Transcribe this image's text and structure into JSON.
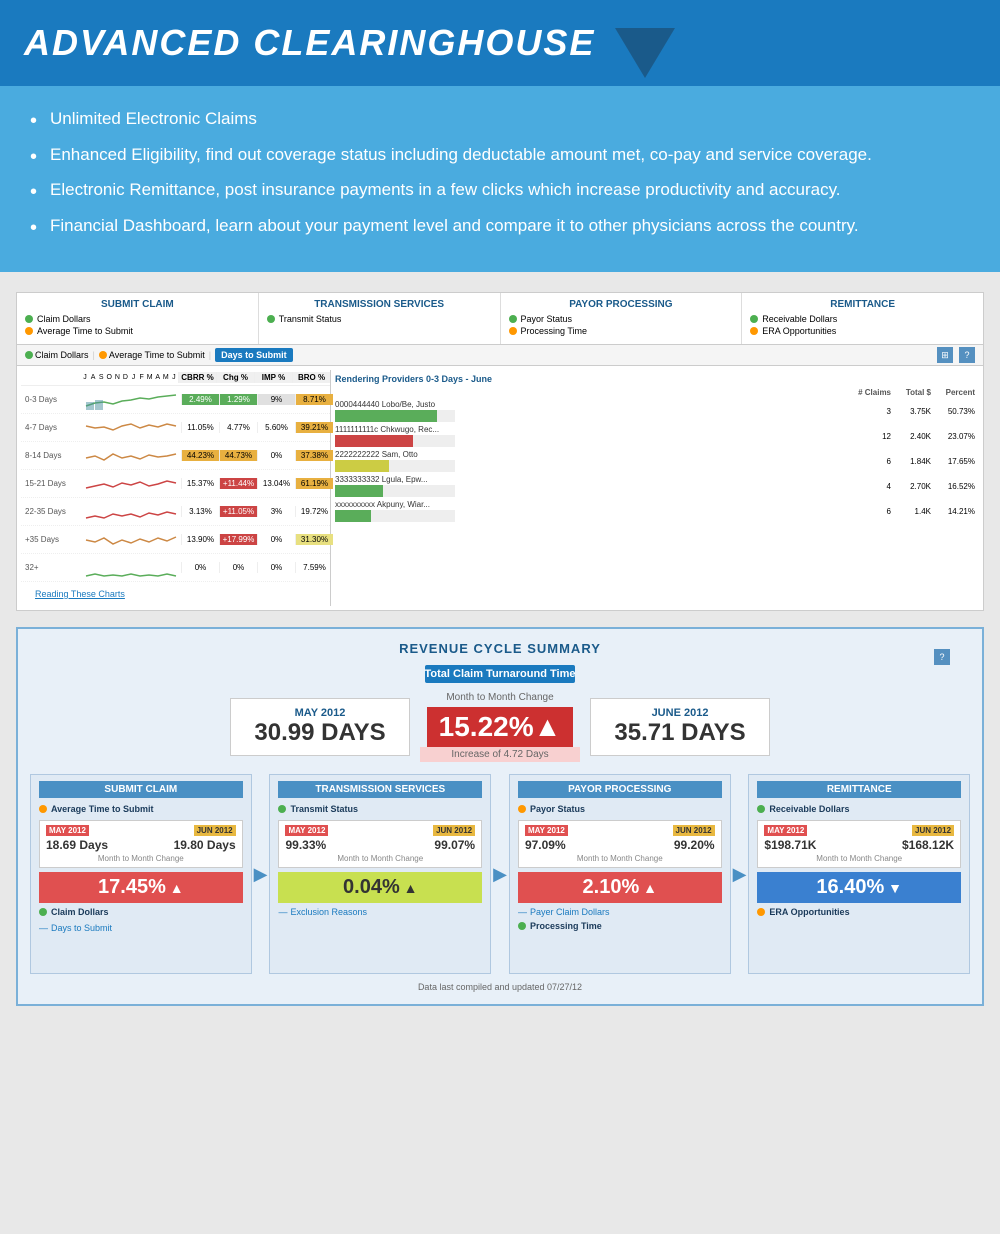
{
  "header": {
    "title": "ADVANCED CLEARINGHOUSE"
  },
  "features": [
    "Unlimited Electronic Claims",
    "Enhanced Eligibility, find out coverage status including deductable amount met, co-pay and service coverage.",
    "Electronic Remittance, post insurance payments in a few clicks which increase productivity and accuracy.",
    "Financial Dashboard, learn about your payment level and compare it to other physicians across the country."
  ],
  "panel1": {
    "columns": [
      {
        "title": "SUBMIT CLAIM",
        "items": [
          "Claim Dollars",
          "Average Time to Submit"
        ]
      },
      {
        "title": "TRANSMISSION SERVICES",
        "items": [
          "Transmit Status"
        ]
      },
      {
        "title": "PAYOR PROCESSING",
        "items": [
          "Payor Status",
          "Processing Time"
        ]
      },
      {
        "title": "REMITTANCE",
        "items": [
          "Receivable Dollars",
          "ERA Opportunities"
        ]
      }
    ],
    "tabs": [
      "Claim Dollars",
      "Average Time to Submit",
      "Days to Submit"
    ],
    "active_tab": "Days to Submit",
    "chart_months": [
      "J",
      "A",
      "S",
      "O",
      "N",
      "D",
      "J",
      "F",
      "M",
      "A",
      "M",
      "J"
    ],
    "chart_rows": [
      {
        "label": "0-3 Days",
        "cbrr": "2.49%",
        "chg": "1.29%",
        "imp": "9%",
        "bro": "8.71%"
      },
      {
        "label": "4-7 Days",
        "cbrr": "11.05%",
        "chg": "4.77%",
        "imp": "5.60%",
        "bro": "39.21%"
      },
      {
        "label": "8-14 Days",
        "cbrr": "44.23%",
        "chg": "44.73%",
        "imp": "0%",
        "bro": "37.38%"
      },
      {
        "label": "15-21 Days",
        "cbrr": "15.37%",
        "chg": "+11.44%",
        "imp": "13.04%",
        "bro": "61.19%"
      },
      {
        "label": "22-35 Days",
        "cbrr": "3.13%",
        "chg": "+11.05%",
        "imp": "3%",
        "bro": "19.72%"
      },
      {
        "label": "+35 Days",
        "cbrr": "13.90%",
        "chg": "+17.99%",
        "imp": "0%",
        "bro": "31.30%"
      },
      {
        "label": "32+",
        "cbrr": "0%",
        "chg": "0%",
        "imp": "0%",
        "bro": "7.59%"
      }
    ],
    "stat_headers": [
      "CBRR %",
      "Chg %",
      "IMP %",
      "BRO %"
    ],
    "provider_section": {
      "title": "Rendering Providers 0-3 Days - June",
      "headers": [
        "# Claims",
        "Total $",
        "Percent"
      ],
      "providers": [
        {
          "name": "0000444440 Lobo/Be, Justo",
          "bar_color": "#5aad5a",
          "bar_width": "85%",
          "claims": "3",
          "total": "3.75K",
          "pct": "50.73%"
        },
        {
          "name": "1111111111c Chkwugo, Rec...",
          "bar_color": "#cc4444",
          "bar_width": "65%",
          "claims": "12",
          "total": "2.40K",
          "pct": "23.07%"
        },
        {
          "name": "2222222222 Sam, Otto",
          "bar_color": "#cccc44",
          "bar_width": "45%",
          "claims": "6",
          "total": "1.84K",
          "pct": "17.65%"
        },
        {
          "name": "3333333332 Lgula, Epw...",
          "bar_color": "#5aad5a",
          "bar_width": "40%",
          "claims": "4",
          "total": "2.70K",
          "pct": "16.52%"
        },
        {
          "name": "xxxxxxxxxx Akpuny, Wiar...",
          "bar_color": "#5aad5a",
          "bar_width": "30%",
          "claims": "6",
          "total": "1.4K",
          "pct": "14.21%"
        }
      ]
    },
    "reading_charts": "Reading These Charts"
  },
  "rcs": {
    "title": "REVENUE CYCLE SUMMARY",
    "subtitle": "Total Claim Turnaround Time",
    "may_label": "MAY 2012",
    "may_value": "30.99 DAYS",
    "change_label": "Month to Month Change",
    "change_pct": "15.22%",
    "change_arrow": "▲",
    "change_sub": "Increase of 4.72 Days",
    "june_label": "JUNE 2012",
    "june_value": "35.71 DAYS",
    "bottom_cols": [
      {
        "title": "SUBMIT CLAIM",
        "metric1_label": "Average Time to Submit",
        "may_date": "MAY 2012",
        "jun_date": "JUN 2012",
        "may_val": "18.69 Days",
        "jun_val": "19.80 Days",
        "change_label": "Month to Month Change",
        "change_pct": "17.45%",
        "change_arrow": "▲",
        "change_dir": "red",
        "metric2_label": "Claim Dollars",
        "metric3_label": "Days to Submit",
        "metric3_dash": true
      },
      {
        "title": "TRANSMISSION SERVICES",
        "metric1_label": "Transmit Status",
        "may_date": "MAY 2012",
        "jun_date": "JUN 2012",
        "may_val": "99.33%",
        "jun_val": "99.07%",
        "change_label": "Month to Month Change",
        "change_pct": "0.04%",
        "change_arrow": "▲",
        "change_dir": "green",
        "metric2_label": "Exclusion Reasons",
        "metric2_dash": true
      },
      {
        "title": "PAYOR PROCESSING",
        "metric1_label": "Payor Status",
        "may_date": "MAY 2012",
        "jun_date": "JUN 2012",
        "may_val": "97.09%",
        "jun_val": "99.20%",
        "change_label": "Month to Month Change",
        "change_pct": "2.10%",
        "change_arrow": "▲",
        "change_dir": "red2",
        "metric2_label": "Payer Claim Dollars",
        "metric2_dash": true,
        "metric3_label": "Processing Time"
      },
      {
        "title": "REMITTANCE",
        "metric1_label": "Receivable Dollars",
        "may_date": "MAY 2012",
        "jun_date": "JUN 2012",
        "may_val": "$198.71K",
        "jun_val": "$168.12K",
        "change_label": "Month to Month Change",
        "change_pct": "16.40%",
        "change_arrow": "▼",
        "change_dir": "blue-down",
        "metric2_label": "ERA Opportunities"
      }
    ],
    "data_footer": "Data last compiled and updated 07/27/12"
  }
}
